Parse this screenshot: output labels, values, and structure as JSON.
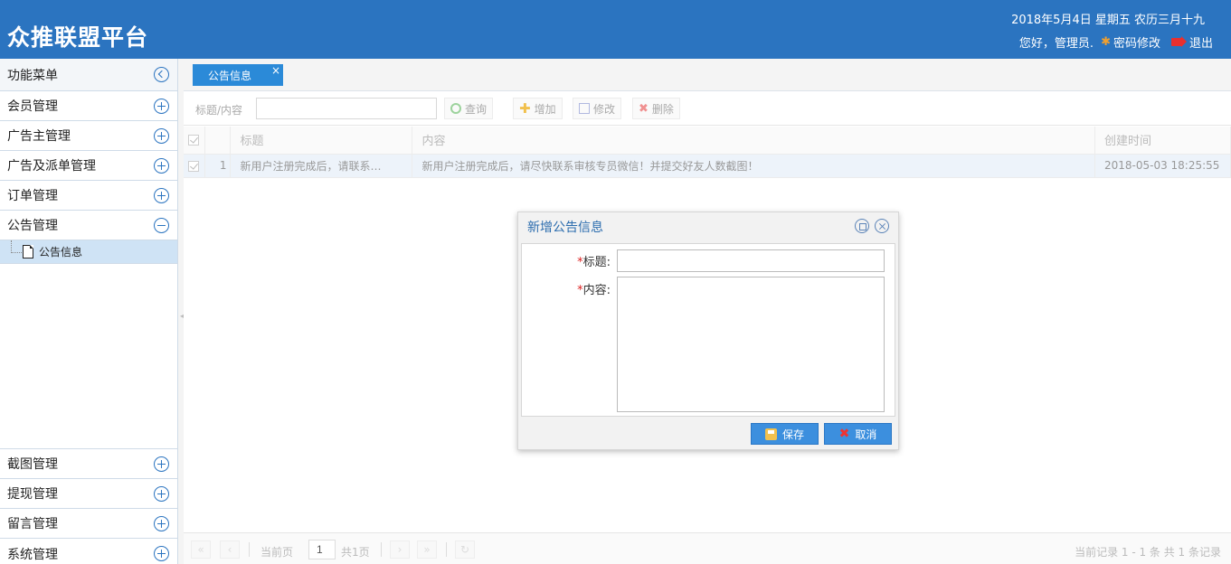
{
  "header": {
    "brand": "众推联盟平台",
    "date": "2018年5月4日 星期五 农历三月十九",
    "greeting": "您好，管理员.",
    "change_password": "密码修改",
    "logout": "退出"
  },
  "sidebar": {
    "title": "功能菜单",
    "items_top": [
      {
        "label": "会员管理"
      },
      {
        "label": "广告主管理"
      },
      {
        "label": "广告及派单管理"
      },
      {
        "label": "订单管理"
      },
      {
        "label": "公告管理"
      }
    ],
    "sub_item": "公告信息",
    "items_bottom": [
      {
        "label": "截图管理"
      },
      {
        "label": "提现管理"
      },
      {
        "label": "留言管理"
      },
      {
        "label": "系统管理"
      }
    ]
  },
  "tab": {
    "label": "公告信息",
    "close": "×"
  },
  "toolbar": {
    "search_label": "标题/内容",
    "query": "查询",
    "add": "增加",
    "edit": "修改",
    "delete": "删除"
  },
  "grid": {
    "columns": [
      "标题",
      "内容",
      "创建时间"
    ],
    "rows": [
      {
        "index": "1",
        "title": "新用户注册完成后，请联系…",
        "content": "新用户注册完成后，请尽快联系审核专员微信！并提交好友人数截图！",
        "created": "2018-05-03 18:25:55"
      }
    ]
  },
  "pager": {
    "current_label": "当前页",
    "page": "1",
    "total": "共1页",
    "summary": "当前记录 1 - 1 条 共 1 条记录"
  },
  "dialog": {
    "title": "新增公告信息",
    "required_mark": "*",
    "title_label": "标题:",
    "content_label": "内容:",
    "save": "保存",
    "cancel": "取消"
  }
}
